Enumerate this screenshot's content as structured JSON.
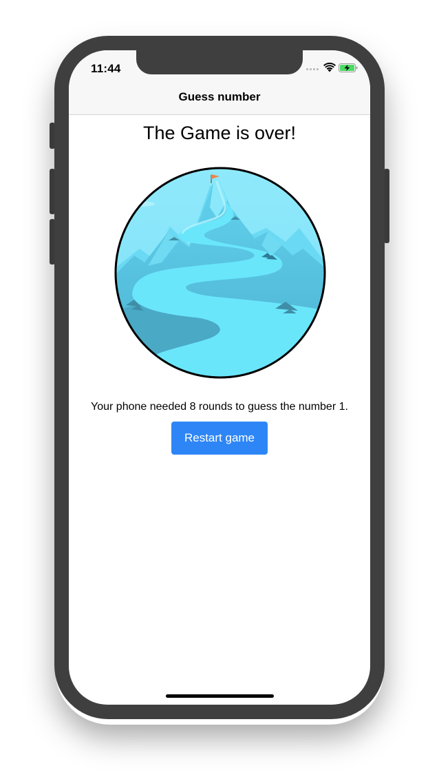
{
  "status_bar": {
    "time": "11:44",
    "wifi_icon": "wifi-icon",
    "battery_icon": "battery-charging-icon",
    "battery_color": "#4cd964"
  },
  "header": {
    "title": "Guess number"
  },
  "game_over": {
    "title": "The Game is over!",
    "illustration": "mountain-summit-illustration",
    "result_text": "Your phone needed 8 rounds to guess the number 1.",
    "restart_label": "Restart game",
    "accent_color": "#2e86f6"
  }
}
